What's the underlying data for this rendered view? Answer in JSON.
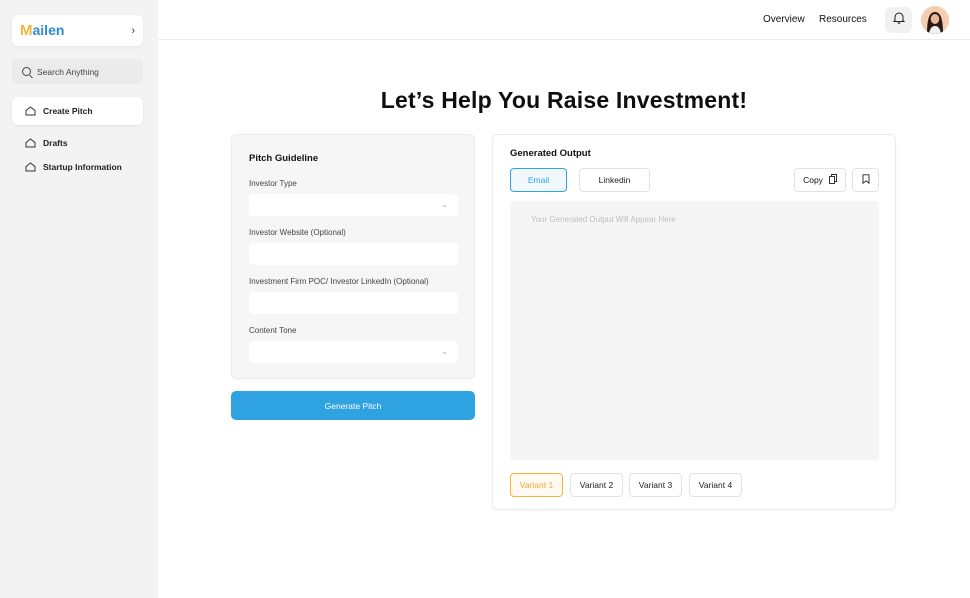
{
  "sidebar": {
    "brand_m": "M",
    "brand_rest": "ailen",
    "search_placeholder": "Search Anything",
    "items": [
      {
        "label": "Create Pitch",
        "active": true,
        "icon": "home-icon"
      },
      {
        "label": "Drafts",
        "active": false,
        "icon": "home-icon"
      },
      {
        "label": "Startup Information",
        "active": false,
        "icon": "home-icon"
      }
    ]
  },
  "header": {
    "links": [
      "Overview",
      "Resources"
    ],
    "bell_icon": "bell-icon",
    "avatar_icon": "user-avatar"
  },
  "main": {
    "title": "Let’s Help You Raise Investment!",
    "pitch": {
      "title": "Pitch Guideline",
      "fields": [
        {
          "label": "Investor Type",
          "value": "",
          "type": "select"
        },
        {
          "label": "Investor Website (Optional)",
          "value": "",
          "type": "text"
        },
        {
          "label": "Investment Firm POC/ Investor LinkedIn (Optional)",
          "value": "",
          "type": "text"
        },
        {
          "label": "Content Tone",
          "value": "",
          "type": "select"
        }
      ],
      "generate_label": "Generate Pitch"
    },
    "output": {
      "title": "Generated Output",
      "tabs": [
        "Email",
        "Linkedin"
      ],
      "active_tab": "Email",
      "copy_label": "Copy",
      "placeholder": "Your Generated Output Will Appear Here",
      "variants": [
        "Variant 1",
        "Variant 2",
        "Variant 3",
        "Variant 4"
      ],
      "active_variant": "Variant 1"
    }
  },
  "colors": {
    "accent": "#2fa2e2",
    "variant_accent": "#f5b53b",
    "brand_m": "#f5b53b",
    "brand_text": "#2d8bd6"
  }
}
